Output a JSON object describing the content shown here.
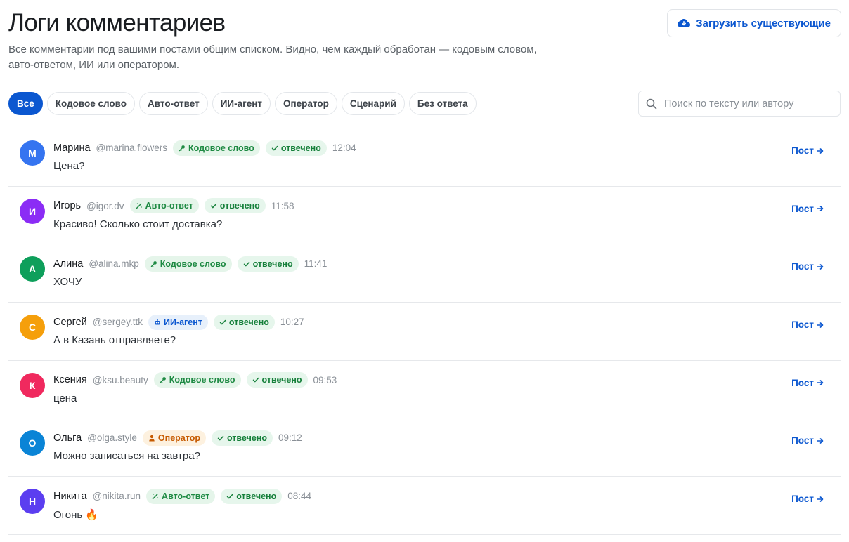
{
  "header": {
    "title": "Логи комментариев",
    "subtitle": "Все комментарии под вашими постами общим списком. Видно, чем каждый обработан — кодовым словом, авто-ответом, ИИ или оператором.",
    "load_button": "Загрузить существующие",
    "load_icon": "cloud-download-icon"
  },
  "filters": [
    {
      "label": "Все",
      "active": true
    },
    {
      "label": "Кодовое слово",
      "active": false
    },
    {
      "label": "Авто-ответ",
      "active": false
    },
    {
      "label": "ИИ-агент",
      "active": false
    },
    {
      "label": "Оператор",
      "active": false
    },
    {
      "label": "Сценарий",
      "active": false
    },
    {
      "label": "Без ответа",
      "active": false
    }
  ],
  "search": {
    "placeholder": "Поиск по тексту или автору",
    "icon": "search-icon"
  },
  "status_label": "отвечено",
  "post_link_label": "Пост",
  "colors": {
    "accent": "#0b57d0"
  },
  "comments": [
    {
      "initial": "М",
      "avatar_color": "#3574f0",
      "name": "Марина",
      "handle": "@marina.flowers",
      "source": "Кодовое слово",
      "source_kind": "keyword",
      "time": "12:04",
      "text": "Цена?"
    },
    {
      "initial": "И",
      "avatar_color": "#8b2cf5",
      "name": "Игорь",
      "handle": "@igor.dv",
      "source": "Авто-ответ",
      "source_kind": "auto",
      "time": "11:58",
      "text": "Красиво! Сколько стоит доставка?"
    },
    {
      "initial": "А",
      "avatar_color": "#0e9f5b",
      "name": "Алина",
      "handle": "@alina.mkp",
      "source": "Кодовое слово",
      "source_kind": "keyword",
      "time": "11:41",
      "text": "ХОЧУ"
    },
    {
      "initial": "С",
      "avatar_color": "#f59f0b",
      "name": "Сергей",
      "handle": "@sergey.ttk",
      "source": "ИИ-агент",
      "source_kind": "ai",
      "time": "10:27",
      "text": "А в Казань отправляете?"
    },
    {
      "initial": "К",
      "avatar_color": "#f0295e",
      "name": "Ксения",
      "handle": "@ksu.beauty",
      "source": "Кодовое слово",
      "source_kind": "keyword",
      "time": "09:53",
      "text": "цена"
    },
    {
      "initial": "О",
      "avatar_color": "#0a84d6",
      "name": "Ольга",
      "handle": "@olga.style",
      "source": "Оператор",
      "source_kind": "operator",
      "time": "09:12",
      "text": "Можно записаться на завтра?"
    },
    {
      "initial": "Н",
      "avatar_color": "#5b3ef0",
      "name": "Никита",
      "handle": "@nikita.run",
      "source": "Авто-ответ",
      "source_kind": "auto",
      "time": "08:44",
      "text": "Огонь 🔥"
    }
  ]
}
